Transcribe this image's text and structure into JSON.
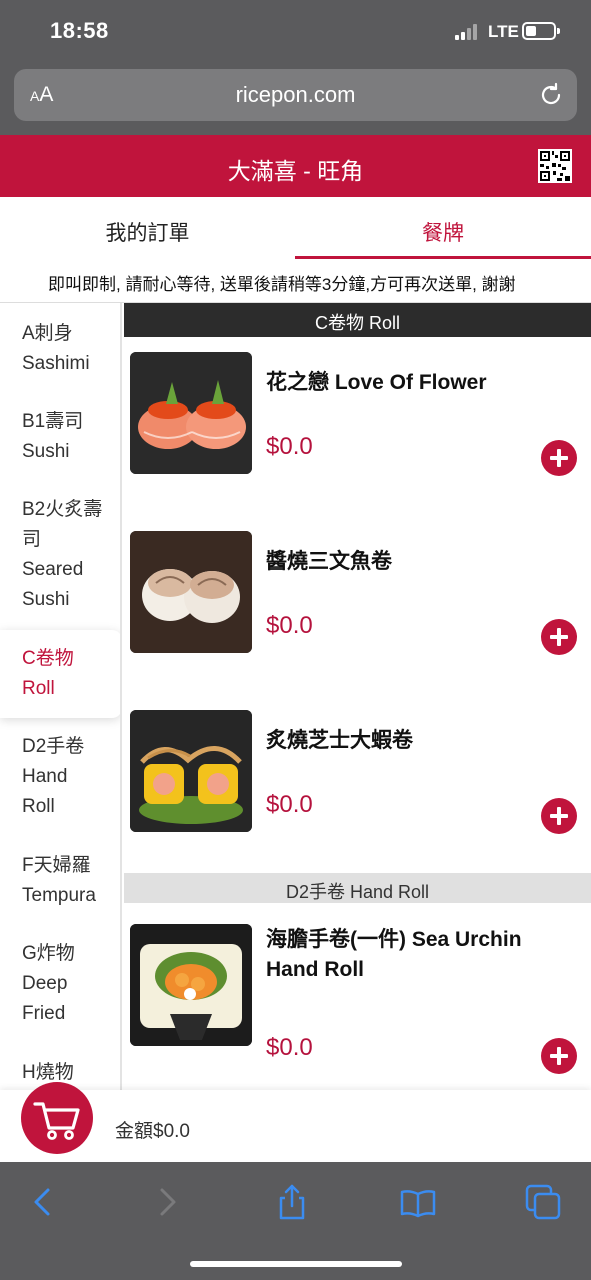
{
  "status_bar": {
    "time": "18:58",
    "network": "LTE"
  },
  "browser": {
    "aa_label_small": "A",
    "aa_label_large": "A",
    "url": "ricepon.com",
    "reload_icon": "reload-icon"
  },
  "header": {
    "title": "大滿喜 - 旺角",
    "qr_icon": "qr-code-icon"
  },
  "tabs": [
    {
      "label": "我的訂單"
    },
    {
      "label": "餐牌",
      "active": true
    }
  ],
  "notice": "即叫即制, 請耐心等待, 送單後請稍等3分鐘,方可再次送單, 謝謝",
  "categories": [
    {
      "line1": "A刺身",
      "line2": "Sashimi"
    },
    {
      "line1": "B1壽司",
      "line2": "Sushi"
    },
    {
      "line1": "B2火炙壽",
      "line2": "司",
      "line3": "Seared",
      "line4": "Sushi"
    },
    {
      "line1": "C卷物",
      "line2": "Roll",
      "active": true
    },
    {
      "line1": "D2手卷",
      "line2": "Hand",
      "line3": "Roll"
    },
    {
      "line1": "F天婦羅",
      "line2": "Tempura"
    },
    {
      "line1": "G炸物",
      "line2": "Deep",
      "line3": "Fried"
    },
    {
      "line1": "H燒物"
    }
  ],
  "sections": [
    {
      "title": "C卷物 Roll",
      "items": [
        {
          "name": "花之戀 Love Of Flower",
          "price": "$0.0"
        },
        {
          "name": "醬燒三文魚卷",
          "price": "$0.0"
        },
        {
          "name": "炙燒芝士大蝦卷",
          "price": "$0.0"
        }
      ]
    },
    {
      "title": "D2手卷 Hand Roll",
      "items": [
        {
          "name_line1": "海膽手卷(一件) Sea Urchin",
          "name_line2": "Hand Roll",
          "price": "$0.0"
        }
      ]
    }
  ],
  "cart": {
    "amount_label": "金額$0.0",
    "icon": "shopping-cart-icon"
  },
  "colors": {
    "brand": "#c0143c",
    "price": "#b5123d",
    "chrome": "#5b5b5d"
  },
  "toolbar_icons": [
    "back-icon",
    "forward-icon",
    "share-icon",
    "bookmarks-icon",
    "tabs-icon"
  ]
}
